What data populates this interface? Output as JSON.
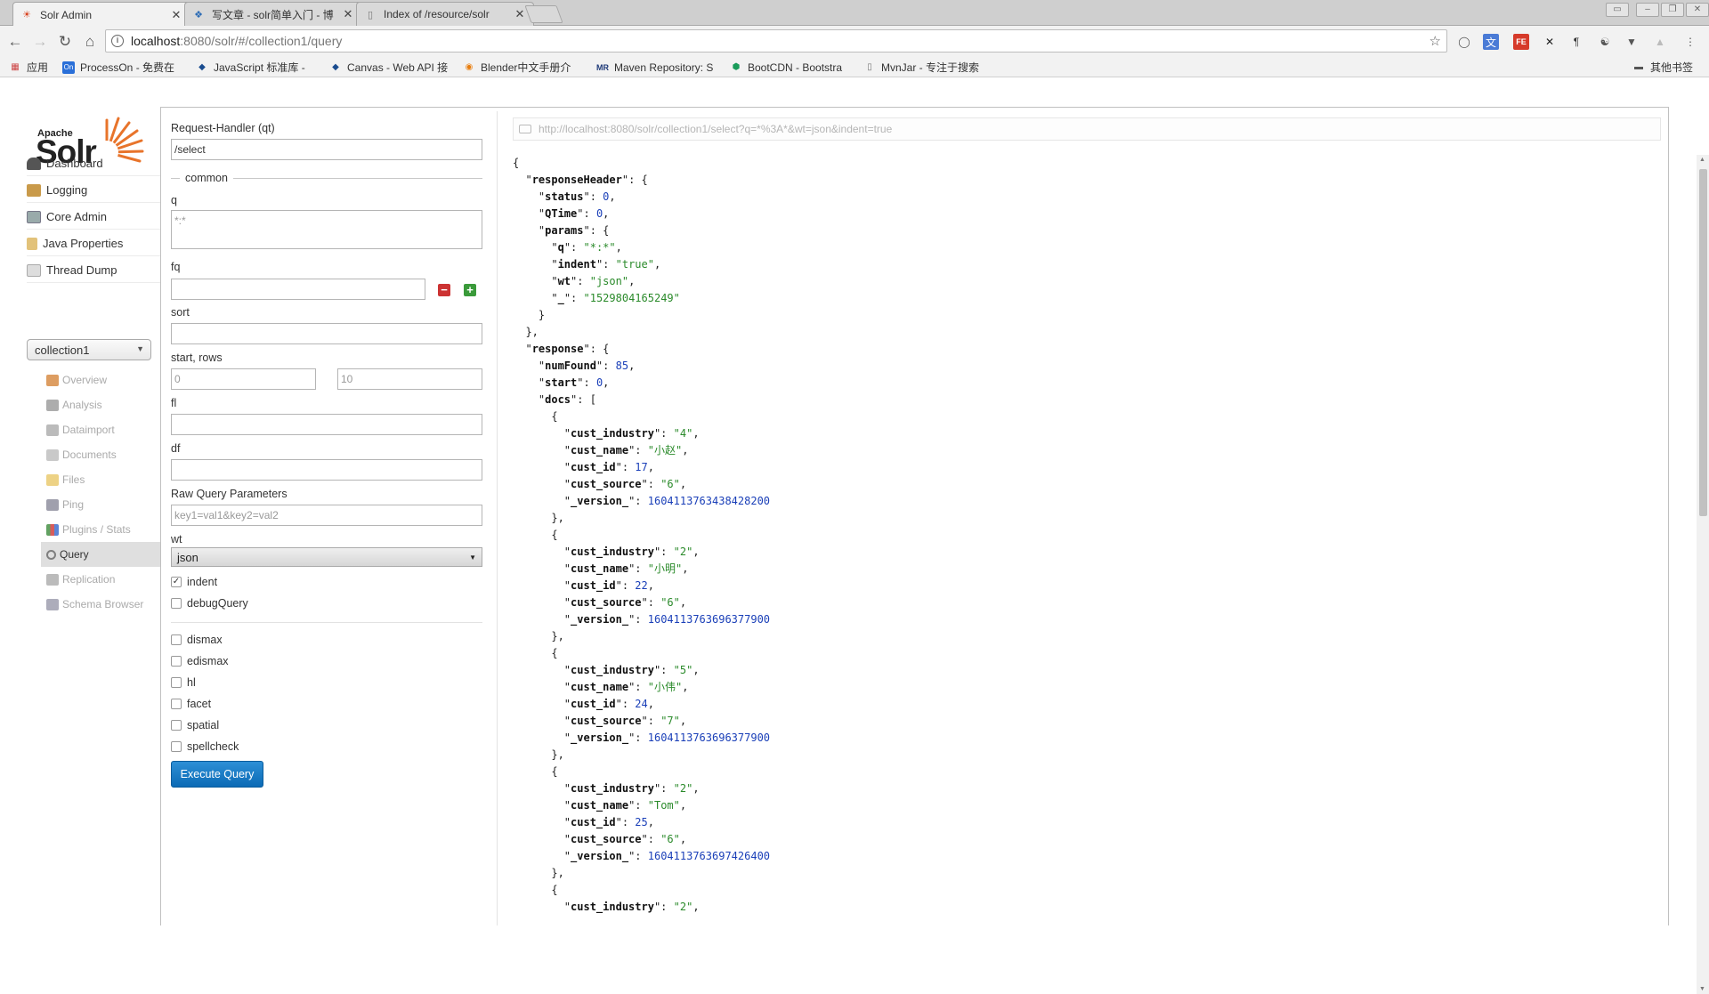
{
  "browser": {
    "tabs": [
      {
        "title": "Solr Admin",
        "active": true
      },
      {
        "title": "写文章 - solr简单入门 - 博",
        "active": false
      },
      {
        "title": "Index of /resource/solr",
        "active": false
      }
    ],
    "url_host": "localhost",
    "url_path": ":8080/solr/#/collection1/query",
    "bookmarks": [
      "应用",
      "ProcessOn - 免费在",
      "JavaScript 标准库 -",
      "Canvas - Web API 接",
      "Blender中文手册介",
      "Maven Repository: S",
      "BootCDN - Bootstra",
      "MvnJar - 专注于搜索",
      "其他书签"
    ]
  },
  "logo": {
    "apache": "Apache",
    "solr": "Solr"
  },
  "nav": {
    "items": [
      "Dashboard",
      "Logging",
      "Core Admin",
      "Java Properties",
      "Thread Dump"
    ],
    "core": "collection1",
    "core_items": [
      "Overview",
      "Analysis",
      "Dataimport",
      "Documents",
      "Files",
      "Ping",
      "Plugins / Stats",
      "Query",
      "Replication",
      "Schema Browser"
    ],
    "active_core_item": "Query"
  },
  "form": {
    "request_handler_label": "Request-Handler (qt)",
    "request_handler_value": "/select",
    "common_legend": "common",
    "q_label": "q",
    "q_value": "*:*",
    "fq_label": "fq",
    "sort_label": "sort",
    "start_rows_label": "start, rows",
    "start_value": "0",
    "rows_value": "10",
    "fl_label": "fl",
    "df_label": "df",
    "raw_label": "Raw Query Parameters",
    "raw_placeholder": "key1=val1&key2=val2",
    "wt_label": "wt",
    "wt_value": "json",
    "indent_label": "indent",
    "debug_label": "debugQuery",
    "options": [
      "dismax",
      "edismax",
      "hl",
      "facet",
      "spatial",
      "spellcheck"
    ],
    "execute_label": "Execute Query"
  },
  "result": {
    "url": "http://localhost:8080/solr/collection1/select?q=*%3A*&wt=json&indent=true",
    "lines": [
      [
        [
          "p",
          "{"
        ]
      ],
      [
        [
          "p",
          "  \""
        ],
        [
          "k",
          "responseHeader"
        ],
        [
          "p",
          "\": {"
        ]
      ],
      [
        [
          "p",
          "    \""
        ],
        [
          "k",
          "status"
        ],
        [
          "p",
          "\": "
        ],
        [
          "n",
          "0"
        ],
        [
          "p",
          ","
        ]
      ],
      [
        [
          "p",
          "    \""
        ],
        [
          "k",
          "QTime"
        ],
        [
          "p",
          "\": "
        ],
        [
          "n",
          "0"
        ],
        [
          "p",
          ","
        ]
      ],
      [
        [
          "p",
          "    \""
        ],
        [
          "k",
          "params"
        ],
        [
          "p",
          "\": {"
        ]
      ],
      [
        [
          "p",
          "      \""
        ],
        [
          "k",
          "q"
        ],
        [
          "p",
          "\": "
        ],
        [
          "s",
          "\"*:*\""
        ],
        [
          "p",
          ","
        ]
      ],
      [
        [
          "p",
          "      \""
        ],
        [
          "k",
          "indent"
        ],
        [
          "p",
          "\": "
        ],
        [
          "s",
          "\"true\""
        ],
        [
          "p",
          ","
        ]
      ],
      [
        [
          "p",
          "      \""
        ],
        [
          "k",
          "wt"
        ],
        [
          "p",
          "\": "
        ],
        [
          "s",
          "\"json\""
        ],
        [
          "p",
          ","
        ]
      ],
      [
        [
          "p",
          "      \""
        ],
        [
          "k",
          "_"
        ],
        [
          "p",
          "\": "
        ],
        [
          "s",
          "\"1529804165249\""
        ]
      ],
      [
        [
          "p",
          "    }"
        ]
      ],
      [
        [
          "p",
          "  },"
        ]
      ],
      [
        [
          "p",
          "  \""
        ],
        [
          "k",
          "response"
        ],
        [
          "p",
          "\": {"
        ]
      ],
      [
        [
          "p",
          "    \""
        ],
        [
          "k",
          "numFound"
        ],
        [
          "p",
          "\": "
        ],
        [
          "n",
          "85"
        ],
        [
          "p",
          ","
        ]
      ],
      [
        [
          "p",
          "    \""
        ],
        [
          "k",
          "start"
        ],
        [
          "p",
          "\": "
        ],
        [
          "n",
          "0"
        ],
        [
          "p",
          ","
        ]
      ],
      [
        [
          "p",
          "    \""
        ],
        [
          "k",
          "docs"
        ],
        [
          "p",
          "\": ["
        ]
      ],
      [
        [
          "p",
          "      {"
        ]
      ],
      [
        [
          "p",
          "        \""
        ],
        [
          "k",
          "cust_industry"
        ],
        [
          "p",
          "\": "
        ],
        [
          "s",
          "\"4\""
        ],
        [
          "p",
          ","
        ]
      ],
      [
        [
          "p",
          "        \""
        ],
        [
          "k",
          "cust_name"
        ],
        [
          "p",
          "\": "
        ],
        [
          "s",
          "\"小赵\""
        ],
        [
          "p",
          ","
        ]
      ],
      [
        [
          "p",
          "        \""
        ],
        [
          "k",
          "cust_id"
        ],
        [
          "p",
          "\": "
        ],
        [
          "n",
          "17"
        ],
        [
          "p",
          ","
        ]
      ],
      [
        [
          "p",
          "        \""
        ],
        [
          "k",
          "cust_source"
        ],
        [
          "p",
          "\": "
        ],
        [
          "s",
          "\"6\""
        ],
        [
          "p",
          ","
        ]
      ],
      [
        [
          "p",
          "        \""
        ],
        [
          "k",
          "_version_"
        ],
        [
          "p",
          "\": "
        ],
        [
          "n",
          "1604113763438428200"
        ]
      ],
      [
        [
          "p",
          "      },"
        ]
      ],
      [
        [
          "p",
          "      {"
        ]
      ],
      [
        [
          "p",
          "        \""
        ],
        [
          "k",
          "cust_industry"
        ],
        [
          "p",
          "\": "
        ],
        [
          "s",
          "\"2\""
        ],
        [
          "p",
          ","
        ]
      ],
      [
        [
          "p",
          "        \""
        ],
        [
          "k",
          "cust_name"
        ],
        [
          "p",
          "\": "
        ],
        [
          "s",
          "\"小明\""
        ],
        [
          "p",
          ","
        ]
      ],
      [
        [
          "p",
          "        \""
        ],
        [
          "k",
          "cust_id"
        ],
        [
          "p",
          "\": "
        ],
        [
          "n",
          "22"
        ],
        [
          "p",
          ","
        ]
      ],
      [
        [
          "p",
          "        \""
        ],
        [
          "k",
          "cust_source"
        ],
        [
          "p",
          "\": "
        ],
        [
          "s",
          "\"6\""
        ],
        [
          "p",
          ","
        ]
      ],
      [
        [
          "p",
          "        \""
        ],
        [
          "k",
          "_version_"
        ],
        [
          "p",
          "\": "
        ],
        [
          "n",
          "1604113763696377900"
        ]
      ],
      [
        [
          "p",
          "      },"
        ]
      ],
      [
        [
          "p",
          "      {"
        ]
      ],
      [
        [
          "p",
          "        \""
        ],
        [
          "k",
          "cust_industry"
        ],
        [
          "p",
          "\": "
        ],
        [
          "s",
          "\"5\""
        ],
        [
          "p",
          ","
        ]
      ],
      [
        [
          "p",
          "        \""
        ],
        [
          "k",
          "cust_name"
        ],
        [
          "p",
          "\": "
        ],
        [
          "s",
          "\"小伟\""
        ],
        [
          "p",
          ","
        ]
      ],
      [
        [
          "p",
          "        \""
        ],
        [
          "k",
          "cust_id"
        ],
        [
          "p",
          "\": "
        ],
        [
          "n",
          "24"
        ],
        [
          "p",
          ","
        ]
      ],
      [
        [
          "p",
          "        \""
        ],
        [
          "k",
          "cust_source"
        ],
        [
          "p",
          "\": "
        ],
        [
          "s",
          "\"7\""
        ],
        [
          "p",
          ","
        ]
      ],
      [
        [
          "p",
          "        \""
        ],
        [
          "k",
          "_version_"
        ],
        [
          "p",
          "\": "
        ],
        [
          "n",
          "1604113763696377900"
        ]
      ],
      [
        [
          "p",
          "      },"
        ]
      ],
      [
        [
          "p",
          "      {"
        ]
      ],
      [
        [
          "p",
          "        \""
        ],
        [
          "k",
          "cust_industry"
        ],
        [
          "p",
          "\": "
        ],
        [
          "s",
          "\"2\""
        ],
        [
          "p",
          ","
        ]
      ],
      [
        [
          "p",
          "        \""
        ],
        [
          "k",
          "cust_name"
        ],
        [
          "p",
          "\": "
        ],
        [
          "s",
          "\"Tom\""
        ],
        [
          "p",
          ","
        ]
      ],
      [
        [
          "p",
          "        \""
        ],
        [
          "k",
          "cust_id"
        ],
        [
          "p",
          "\": "
        ],
        [
          "n",
          "25"
        ],
        [
          "p",
          ","
        ]
      ],
      [
        [
          "p",
          "        \""
        ],
        [
          "k",
          "cust_source"
        ],
        [
          "p",
          "\": "
        ],
        [
          "s",
          "\"6\""
        ],
        [
          "p",
          ","
        ]
      ],
      [
        [
          "p",
          "        \""
        ],
        [
          "k",
          "_version_"
        ],
        [
          "p",
          "\": "
        ],
        [
          "n",
          "1604113763697426400"
        ]
      ],
      [
        [
          "p",
          "      },"
        ]
      ],
      [
        [
          "p",
          "      {"
        ]
      ],
      [
        [
          "p",
          "        \""
        ],
        [
          "k",
          "cust_industry"
        ],
        [
          "p",
          "\": "
        ],
        [
          "s",
          "\"2\""
        ],
        [
          "p",
          ","
        ]
      ]
    ]
  }
}
